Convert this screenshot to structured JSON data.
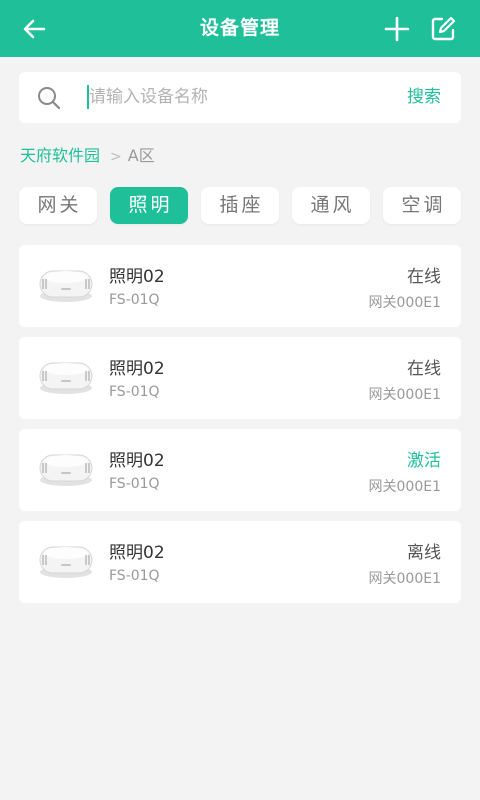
{
  "header": {
    "title": "设备管理",
    "back_icon": "arrow-left-icon",
    "add_icon": "plus-icon",
    "edit_icon": "edit-icon",
    "color": "#1fbf9a"
  },
  "search": {
    "placeholder": "请输入设备名称",
    "value": "",
    "button": "搜索",
    "icon": "search-icon"
  },
  "breadcrumb": {
    "park": "天府软件园",
    "separator": ">",
    "area": "A区"
  },
  "tabs": [
    {
      "label": "网关",
      "active": false
    },
    {
      "label": "照明",
      "active": true
    },
    {
      "label": "插座",
      "active": false
    },
    {
      "label": "通风",
      "active": false
    },
    {
      "label": "空调",
      "active": false
    }
  ],
  "devices": [
    {
      "name": "照明02",
      "model": "FS-01Q",
      "status": "在线",
      "gateway": "网关000E1",
      "status_color": "#555555"
    },
    {
      "name": "照明02",
      "model": "FS-01Q",
      "status": "在线",
      "gateway": "网关000E1",
      "status_color": "#555555"
    },
    {
      "name": "照明02",
      "model": "FS-01Q",
      "status": "激活",
      "gateway": "网关000E1",
      "status_color": "#1fbf9a"
    },
    {
      "name": "照明02",
      "model": "FS-01Q",
      "status": "离线",
      "gateway": "网关000E1",
      "status_color": "#555555"
    }
  ]
}
